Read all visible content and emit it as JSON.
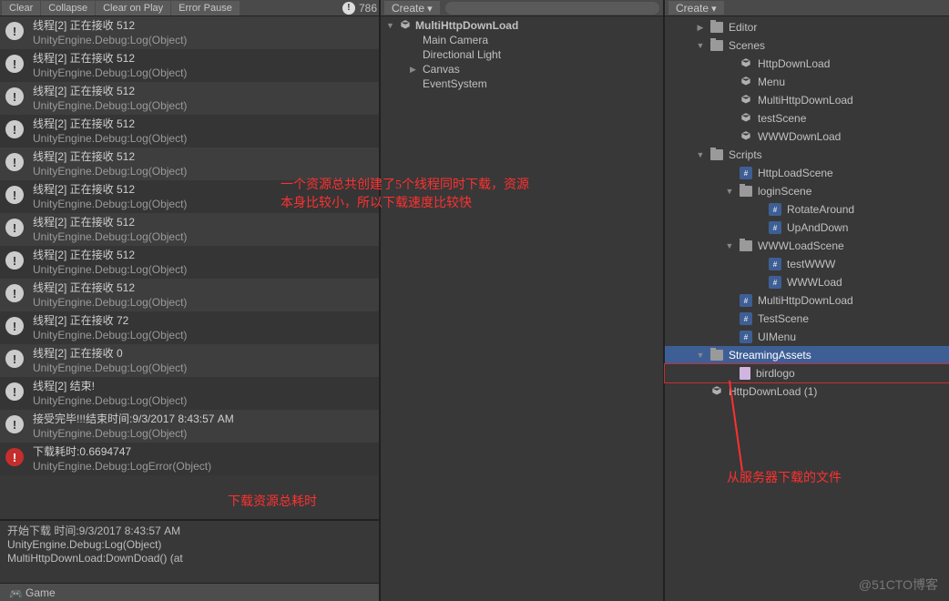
{
  "console": {
    "toolbar": {
      "clear": "Clear",
      "collapse": "Collapse",
      "clear_on_play": "Clear on Play",
      "error_pause": "Error Pause",
      "msg_count": "786"
    },
    "logs": [
      {
        "kind": "info",
        "l1": "线程[2] 正在接收 512",
        "l2": "UnityEngine.Debug:Log(Object)"
      },
      {
        "kind": "info",
        "l1": "线程[2] 正在接收 512",
        "l2": "UnityEngine.Debug:Log(Object)"
      },
      {
        "kind": "info",
        "l1": "线程[2] 正在接收 512",
        "l2": "UnityEngine.Debug:Log(Object)"
      },
      {
        "kind": "info",
        "l1": "线程[2] 正在接收 512",
        "l2": "UnityEngine.Debug:Log(Object)"
      },
      {
        "kind": "info",
        "l1": "线程[2] 正在接收 512",
        "l2": "UnityEngine.Debug:Log(Object)"
      },
      {
        "kind": "info",
        "l1": "线程[2] 正在接收 512",
        "l2": "UnityEngine.Debug:Log(Object)"
      },
      {
        "kind": "info",
        "l1": "线程[2] 正在接收 512",
        "l2": "UnityEngine.Debug:Log(Object)"
      },
      {
        "kind": "info",
        "l1": "线程[2] 正在接收 512",
        "l2": "UnityEngine.Debug:Log(Object)"
      },
      {
        "kind": "info",
        "l1": "线程[2] 正在接收 512",
        "l2": "UnityEngine.Debug:Log(Object)"
      },
      {
        "kind": "info",
        "l1": "线程[2] 正在接收 72",
        "l2": "UnityEngine.Debug:Log(Object)"
      },
      {
        "kind": "info",
        "l1": "线程[2] 正在接收 0",
        "l2": "UnityEngine.Debug:Log(Object)"
      },
      {
        "kind": "info",
        "l1": "线程[2] 结束!",
        "l2": "UnityEngine.Debug:Log(Object)"
      },
      {
        "kind": "info",
        "l1": "接受完毕!!!结束时间:9/3/2017 8:43:57 AM",
        "l2": "UnityEngine.Debug:Log(Object)"
      },
      {
        "kind": "err",
        "l1": "下载耗时:0.6694747",
        "l2": "UnityEngine.Debug:LogError(Object)"
      }
    ],
    "detail": {
      "l1": "开始下载 时间:9/3/2017 8:43:57 AM",
      "l2": "UnityEngine.Debug:Log(Object)",
      "l3": "MultiHttpDownLoad:DownDoad() (at"
    },
    "game_tab": "Game"
  },
  "hierarchy": {
    "create": "Create",
    "scene": "MultiHttpDownLoad",
    "items": [
      "Main Camera",
      "Directional Light",
      "Canvas",
      "EventSystem"
    ]
  },
  "project": {
    "create": "Create",
    "items": [
      {
        "depth": 0,
        "fold": "▶",
        "ico": "folder",
        "label": "Editor"
      },
      {
        "depth": 0,
        "fold": "▼",
        "ico": "folder",
        "label": "Scenes"
      },
      {
        "depth": 1,
        "fold": "",
        "ico": "scene",
        "label": "HttpDownLoad"
      },
      {
        "depth": 1,
        "fold": "",
        "ico": "scene",
        "label": "Menu"
      },
      {
        "depth": 1,
        "fold": "",
        "ico": "scene",
        "label": "MultiHttpDownLoad"
      },
      {
        "depth": 1,
        "fold": "",
        "ico": "scene",
        "label": "testScene"
      },
      {
        "depth": 1,
        "fold": "",
        "ico": "scene",
        "label": "WWWDownLoad"
      },
      {
        "depth": 0,
        "fold": "▼",
        "ico": "folder",
        "label": "Scripts"
      },
      {
        "depth": 1,
        "fold": "",
        "ico": "cs",
        "label": "HttpLoadScene"
      },
      {
        "depth": 1,
        "fold": "▼",
        "ico": "folder",
        "label": "loginScene"
      },
      {
        "depth": 2,
        "fold": "",
        "ico": "cs",
        "label": "RotateAround"
      },
      {
        "depth": 2,
        "fold": "",
        "ico": "cs",
        "label": "UpAndDown"
      },
      {
        "depth": 1,
        "fold": "▼",
        "ico": "folder",
        "label": "WWWLoadScene"
      },
      {
        "depth": 2,
        "fold": "",
        "ico": "cs",
        "label": "testWWW"
      },
      {
        "depth": 2,
        "fold": "",
        "ico": "cs",
        "label": "WWWLoad"
      },
      {
        "depth": 1,
        "fold": "",
        "ico": "cs",
        "label": "MultiHttpDownLoad"
      },
      {
        "depth": 1,
        "fold": "",
        "ico": "cs",
        "label": "TestScene"
      },
      {
        "depth": 1,
        "fold": "",
        "ico": "cs",
        "label": "UIMenu"
      },
      {
        "depth": 0,
        "fold": "▼",
        "ico": "folder",
        "label": "StreamingAssets",
        "selected": true
      },
      {
        "depth": 1,
        "fold": "",
        "ico": "asset",
        "label": "birdlogo",
        "boxed": true
      },
      {
        "depth": 0,
        "fold": "",
        "ico": "scene",
        "label": "HttpDownLoad (1)"
      }
    ]
  },
  "annotations": {
    "a1": "一个资源总共创建了5个线程同时下载，资源本身比较小，所以下载速度比较快",
    "a2": "下载资源总耗时",
    "a3": "从服务器下载的文件"
  },
  "watermark": "@51CTO博客"
}
